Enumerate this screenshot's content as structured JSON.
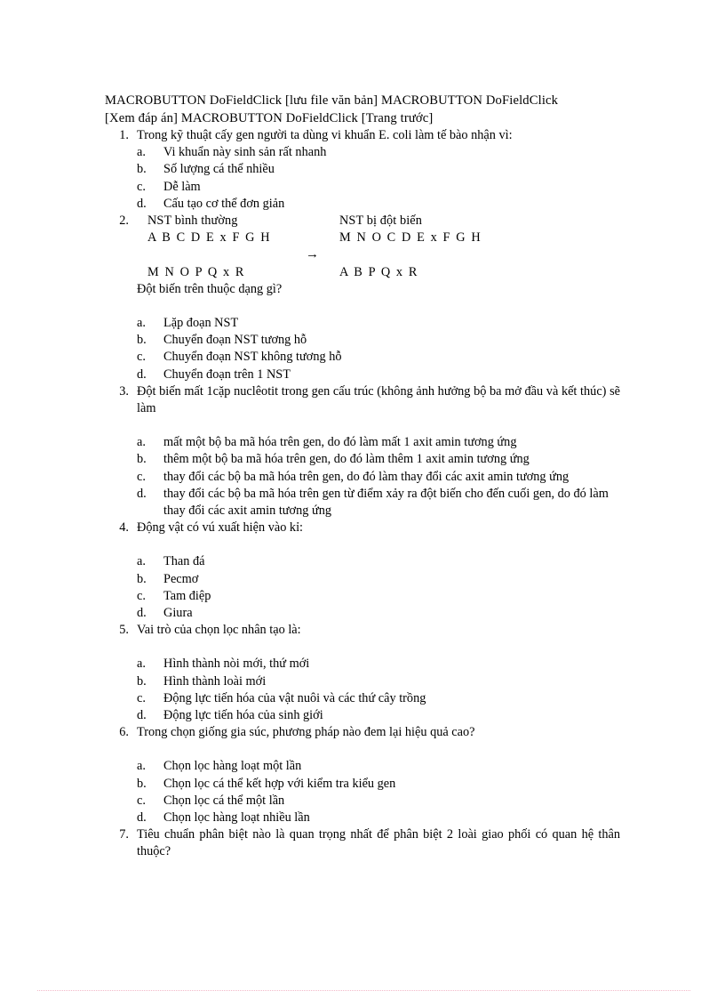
{
  "document": {
    "header": {
      "line1": "MACROBUTTON DoFieldClick   [lưu file văn bản] MACROBUTTON DoFieldClick",
      "line2": "[Xem đáp án] MACROBUTTON DoFieldClick   [Trang trước]"
    },
    "questions": [
      {
        "number": "1.",
        "text": "Trong kỹ thuật cấy gen người ta dùng vi khuẩn E. coli làm tế bào nhận vì:",
        "answers": [
          {
            "letter": "a.",
            "text": "Vi khuẩn này sinh  sản rất nhanh"
          },
          {
            "letter": "b.",
            "text": "Số lượng cá thể nhiều"
          },
          {
            "letter": "c.",
            "text": "Dễ làm"
          },
          {
            "letter": "d.",
            "text": "Cấu tạo cơ thể đơn giản"
          }
        ]
      },
      {
        "number": "2.",
        "label_normal": "NST bình  thường",
        "label_mutant": "NST bị đột biến",
        "chromosome_rows": [
          {
            "left": "A B C D E x F G H",
            "right": "M N O C D E x F G H"
          },
          {
            "left": "M N O P Q x R",
            "right": "A B P Q x R"
          }
        ],
        "arrow": "→",
        "prompt": "Đột biến  trên thuộc  dạng gì?",
        "answers": [
          {
            "letter": "a.",
            "text": "Lặp đoạn NST"
          },
          {
            "letter": "b.",
            "text": "Chuyển  đoạn NST tương hỗ"
          },
          {
            "letter": "c.",
            "text": "Chuyển  đoạn NST không  tương hỗ"
          },
          {
            "letter": "d.",
            "text": "Chuyển  đoạn trên 1 NST"
          }
        ]
      },
      {
        "number": "3.",
        "text": "Đột biến  mất 1cặp nuclêotit  trong gen  cấu trúc (không  ảnh hưởng bộ ba mở đầu và kết thúc)  sẽ làm",
        "answers": [
          {
            "letter": "a.",
            "text": "mất một bộ ba mã hóa trên gen, do đó làm  mất 1 axit  amin  tương ứng"
          },
          {
            "letter": "b.",
            "text": "thêm một bộ ba mã hóa trên gen, do đó làm  thêm  1 axit  amin  tương ứng"
          },
          {
            "letter": "c.",
            "text": "thay đổi các bộ ba mã hóa trên gen, do đó làm  thay  đổi các axit  amin  tương ứng"
          },
          {
            "letter": "d.",
            "text": "thay đổi các bộ ba mã hóa trên gen từ điểm  xảy ra đột biến  cho đến cuối gen,  do đó làm  thay  đổi các axit  amin  tương ứng"
          }
        ]
      },
      {
        "number": "4.",
        "text": "Động vật có vú xuất hiện vào kỉ:",
        "answers": [
          {
            "letter": "a.",
            "text": "Than đá"
          },
          {
            "letter": "b.",
            "text": "Pecmơ"
          },
          {
            "letter": "c.",
            "text": "Tam điệp"
          },
          {
            "letter": "d.",
            "text": "Giura"
          }
        ]
      },
      {
        "number": "5.",
        "text": "Vai trò của chọn lọc nhân tạo là:",
        "answers": [
          {
            "letter": "a.",
            "text": "Hình  thành  nòi mới,  thứ mới"
          },
          {
            "letter": "b.",
            "text": "Hình  thành  loài mới"
          },
          {
            "letter": "c.",
            "text": "Động lực tiến hóa của vật nuôi và các thứ cây trồng"
          },
          {
            "letter": "d.",
            "text": "Động lực tiến hóa của sinh  giới"
          }
        ]
      },
      {
        "number": "6.",
        "text": "Trong chọn giống  gia súc, phương pháp nào đem lại hiệu  quả cao?",
        "answers": [
          {
            "letter": "a.",
            "text": "Chọn lọc hàng loạt một lần"
          },
          {
            "letter": "b.",
            "text": "Chọn lọc cá thể kết hợp với kiểm  tra kiểu gen"
          },
          {
            "letter": "c.",
            "text": "Chọn lọc cá thể một lần"
          },
          {
            "letter": "d.",
            "text": "Chọn lọc hàng loạt nhiều  lần"
          }
        ]
      },
      {
        "number": "7.",
        "text": "Tiêu chuẩn  phân biệt nào là quan trọng nhất để phân biệt 2 loài giao phối có quan hệ thân thuộc?",
        "answers": []
      }
    ]
  },
  "colors": {
    "text": "#000000",
    "page_background": "#ffffff",
    "footer_rule": "#f3b9c9"
  }
}
